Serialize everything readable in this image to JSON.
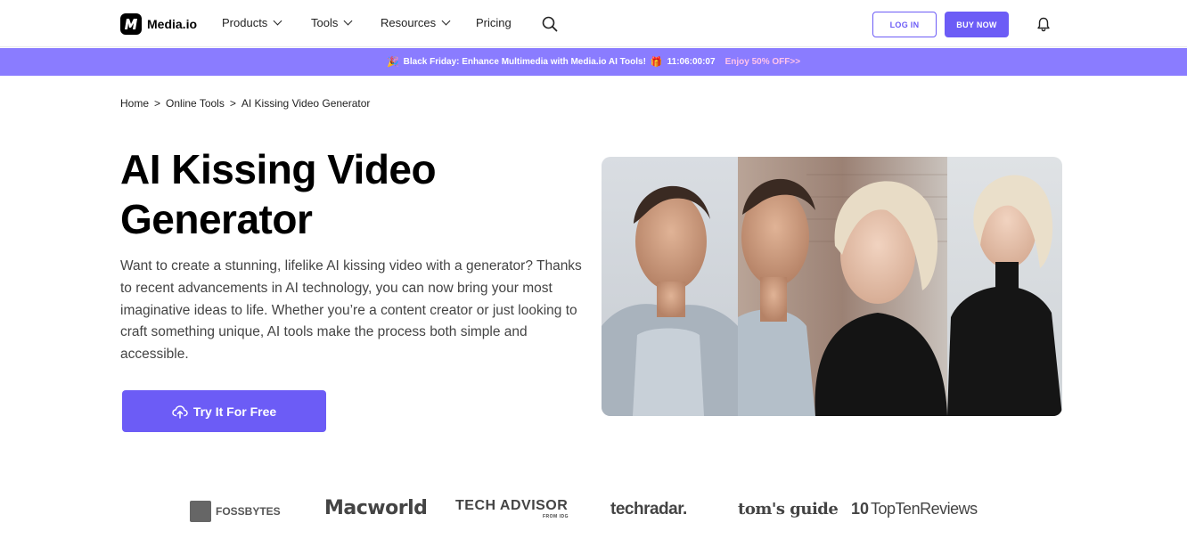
{
  "header": {
    "brand": "Media.io",
    "nav": {
      "products": "Products",
      "tools": "Tools",
      "resources": "Resources",
      "pricing": "Pricing"
    },
    "login_label": "LOG IN",
    "buy_label": "BUY NOW",
    "icons": [
      "search-icon",
      "bell-icon"
    ]
  },
  "promo": {
    "text": "Black Friday: Enhance Multimedia with Media.io AI Tools!",
    "countdown": "11:06:00:07",
    "offer": "Enjoy 50% OFF>>"
  },
  "breadcrumb": {
    "home": "Home",
    "sep1": ">",
    "online_tools": "Online Tools",
    "sep2": ">",
    "current": "AI Kissing Video Generator"
  },
  "hero": {
    "title": "AI Kissing Video Generator",
    "description": "Want to create a stunning, lifelike AI kissing video with a generator? Thanks to recent advancements in AI technology, you can now bring your most imaginative ideas to life. Whether you’re a content creator or just looking to craft something unique, AI tools make the process both simple and accessible.",
    "cta_label": "Try It For Free"
  },
  "press": {
    "logos": [
      "FOSSBYTES",
      "Macworld",
      "TECH ADVISOR",
      "FROM IDG",
      "techradar.",
      "tom's guide",
      "TopTenReviews"
    ]
  },
  "colors": {
    "accent": "#6c5cf6",
    "promo_bg": "#8a7cff",
    "promo_offer": "#ffc2ec"
  }
}
